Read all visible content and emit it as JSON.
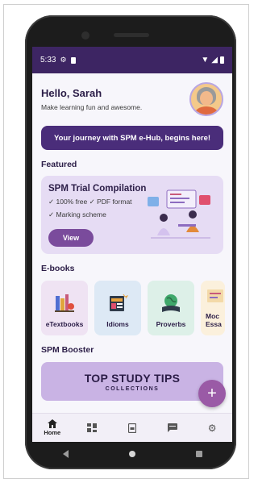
{
  "status": {
    "time": "5:33"
  },
  "greeting": {
    "title": "Hello, Sarah",
    "subtitle": "Make learning fun and awesome."
  },
  "banner": {
    "label": "Your journey with SPM e-Hub, begins here!"
  },
  "featured": {
    "heading": "Featured",
    "card_title": "SPM Trial Compilation",
    "line1": "✓ 100% free  ✓ PDF format",
    "line2": "✓ Marking scheme",
    "button": "View"
  },
  "ebooks": {
    "heading": "E-books",
    "items": [
      {
        "label": "eTextbooks",
        "color": "#efe3f3",
        "icon": "books-icon"
      },
      {
        "label": "Idioms",
        "color": "#dde9f5",
        "icon": "newspaper-icon"
      },
      {
        "label": "Proverbs",
        "color": "#ddf0e8",
        "icon": "globe-book-icon"
      },
      {
        "label": "Moc Essa",
        "color": "#fbf0dc",
        "icon": "essay-icon"
      }
    ]
  },
  "booster": {
    "heading": "SPM Booster",
    "big": "TOP STUDY TIPS",
    "small": "COLLECTIONS"
  },
  "fab": {
    "label": "+"
  },
  "bottomnav": {
    "home_label": "Home"
  },
  "colors": {
    "primary": "#3d2563",
    "accent": "#7a4b9c",
    "fab": "#9a5aa6"
  }
}
